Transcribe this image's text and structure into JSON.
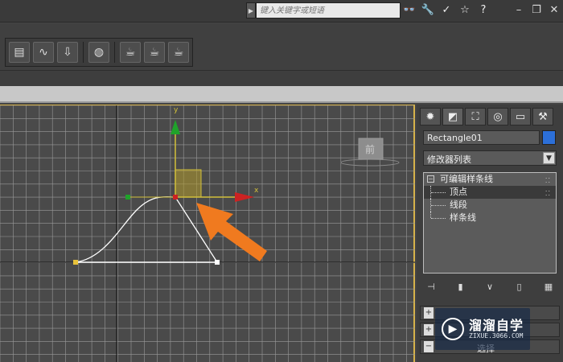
{
  "titlebar": {
    "search_placeholder": "键入关键字或短语",
    "icons": [
      "binoculars-icon",
      "wrench-icon",
      "star-satellite-icon",
      "star-icon",
      "help-icon"
    ],
    "help_glyph": "?",
    "window_buttons": [
      "minimize-icon",
      "restore-icon",
      "close-icon"
    ]
  },
  "toolbar": {
    "tools": [
      "schematic-view-icon",
      "curve-editor-icon",
      "render-setup-icon",
      "material-editor-icon",
      "render-frame-icon",
      "render-icon",
      "quick-render-icon"
    ]
  },
  "viewport": {
    "axis_y_label": "y",
    "axis_x_label": "x",
    "viewcube_label": "前",
    "accent_colors": {
      "grid_line": "#9a9a9a",
      "spline": "#ffffff",
      "y_gizmo": "#1fa32a",
      "x_gizmo": "#cc2222",
      "plane_gizmo": "#d2c03a",
      "arrow": "#f07a1f"
    }
  },
  "command_panel": {
    "tabs": [
      "create-tab",
      "modify-tab",
      "hierarchy-tab",
      "motion-tab",
      "display-tab",
      "utilities-tab"
    ],
    "object_name": "Rectangle01",
    "object_color": "#2c6fd8",
    "modifier_list_label": "修改器列表",
    "stack": {
      "root": "可编辑样条线",
      "children": [
        "顶点",
        "线段",
        "样条线"
      ],
      "selected_index": 0
    },
    "rollup_label": "选择"
  },
  "watermark": {
    "title": "溜溜自学",
    "url": "ZIXUE.3066.COM"
  }
}
